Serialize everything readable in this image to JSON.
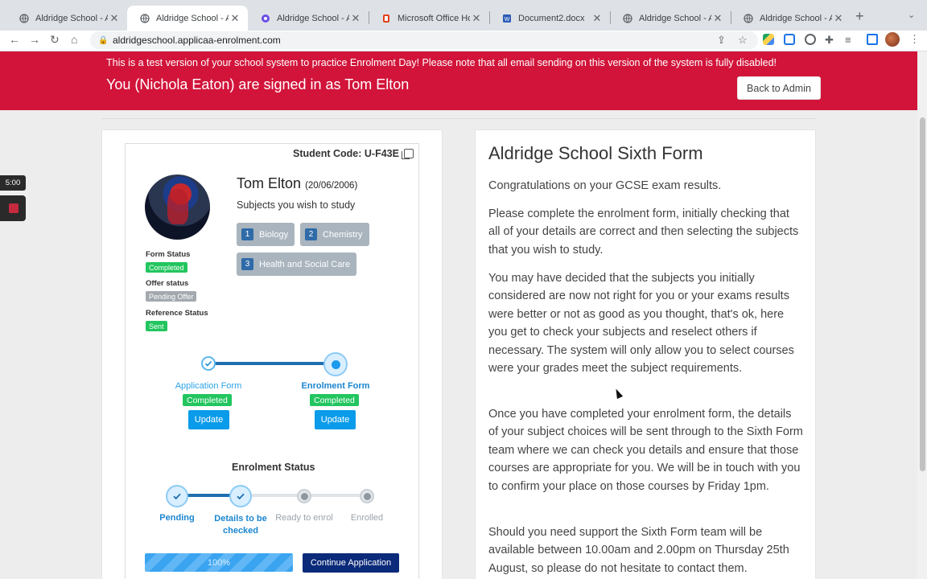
{
  "browser": {
    "tabs": [
      {
        "title": "Aldridge School - A S",
        "icon": "globe-icon",
        "active": false
      },
      {
        "title": "Aldridge School - A S",
        "icon": "globe-icon",
        "active": true
      },
      {
        "title": "Aldridge School - A S",
        "icon": "applicaa-icon",
        "active": false
      },
      {
        "title": "Microsoft Office Hom",
        "icon": "office-icon",
        "active": false
      },
      {
        "title": "Document2.docx",
        "icon": "word-icon",
        "active": false
      },
      {
        "title": "Aldridge School - A S",
        "icon": "globe-icon",
        "active": false
      },
      {
        "title": "Aldridge School - A S",
        "icon": "globe-icon",
        "active": false
      }
    ],
    "url": "aldridgeschool.applicaa-enrolment.com"
  },
  "banner": {
    "notice": "This is a test version of your school system to practice Enrolment Day! Please note that all email sending on this version of the system is fully disabled!",
    "signed_in": "You (Nichola Eaton) are signed in as Tom Elton",
    "back_button": "Back to Admin",
    "color": "#d2143a"
  },
  "student": {
    "code_label": "Student Code: U-F43E",
    "name": "Tom Elton",
    "dob": "(20/06/2006)",
    "subjects_title": "Subjects you wish to study",
    "subjects": [
      {
        "num": "1",
        "name": "Biology"
      },
      {
        "num": "2",
        "name": "Chemistry"
      },
      {
        "num": "3",
        "name": "Health and Social Care"
      }
    ],
    "statuses": [
      {
        "label": "Form Status",
        "value": "Completed",
        "color": "green"
      },
      {
        "label": "Offer status",
        "value": "Pending Offer",
        "color": "grey"
      },
      {
        "label": "Reference Status",
        "value": "Sent",
        "color": "green"
      }
    ]
  },
  "forms": {
    "application": {
      "label": "Application Form",
      "status": "Completed",
      "button": "Update"
    },
    "enrolment": {
      "label": "Enrolment Form",
      "status": "Completed",
      "button": "Update"
    }
  },
  "enrolment_status": {
    "title": "Enrolment Status",
    "steps": [
      "Pending",
      "Details to be checked",
      "Ready to enrol",
      "Enrolled"
    ],
    "progress": "100%",
    "continue_button": "Continue Application"
  },
  "info": {
    "title": "Aldridge School Sixth Form",
    "paragraphs": [
      "Congratulations on your GCSE exam results.",
      "Please complete the enrolment form, initially checking that all of your details are correct and then selecting the subjects that you wish to study.",
      "You may have decided that the subjects you initially considered are now not right for you or your exams results were better or not as good as you thought, that's ok, here you get to check your subjects and reselect others if necessary.  The system will only allow you to select courses were your grades meet the subject requirements.",
      "Once you have completed your enrolment form, the details of your subject choices will be sent through to the Sixth Form team where we can check you details and ensure that those courses are appropriate for you.  We will be in touch with you to confirm your place on those courses by Friday 1pm.",
      "Should you need support the Sixth Form team will be available between 10.00am and 2.00pm on Thursday 25th August, so please do not hesitate to contact them."
    ]
  },
  "overlay": {
    "timer": "5:00"
  }
}
